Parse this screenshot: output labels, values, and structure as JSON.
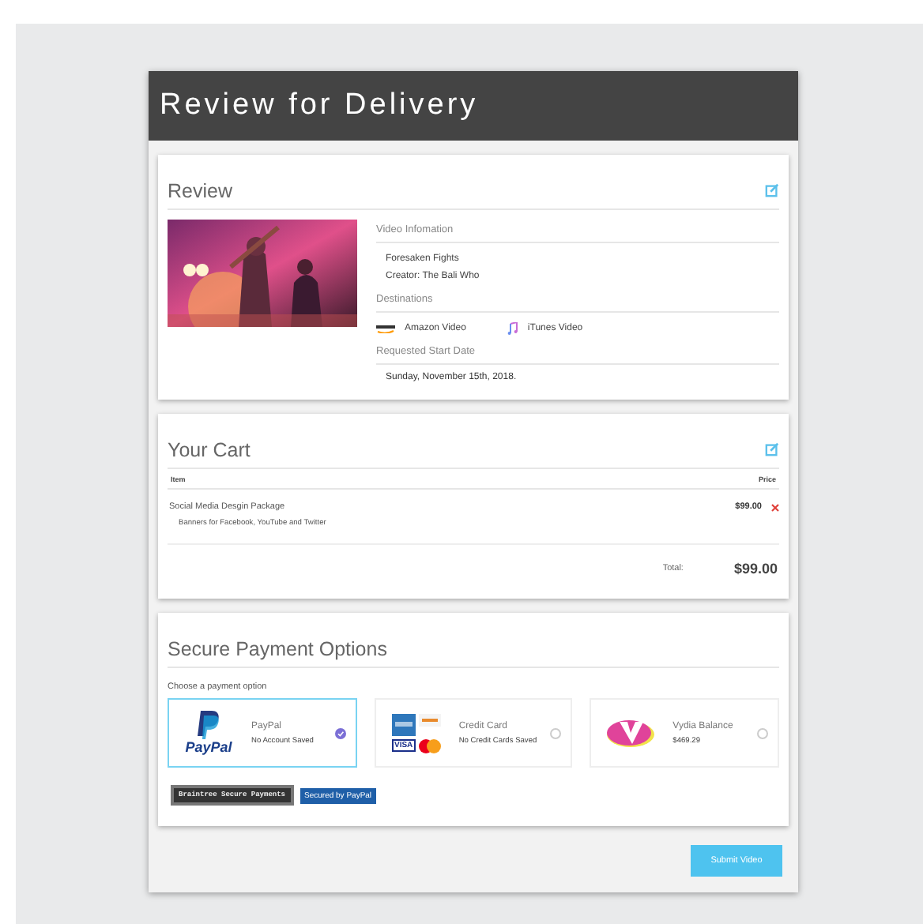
{
  "header": {
    "title": "Review for Delivery"
  },
  "review": {
    "title": "Review",
    "video_heading": "Video Infomation",
    "video_title": "Foresaken Fights",
    "creator": "Creator: The Bali Who",
    "destinations_heading": "Destinations",
    "destinations": [
      {
        "kind": "amazon",
        "label": "Amazon Video"
      },
      {
        "kind": "itunes",
        "label": "iTunes Video"
      }
    ],
    "date_heading": "Requested Start Date",
    "date": "Sunday, November 15th, 2018."
  },
  "cart": {
    "title": "Your Cart",
    "columns": [
      "Item",
      "Price"
    ],
    "items": [
      {
        "name": "Social Media Desgin Package",
        "description": "Banners for Facebook, YouTube and Twitter",
        "price": "$99.00"
      }
    ],
    "total_label": "Total:",
    "total": "$99.00"
  },
  "payment": {
    "title": "Secure Payment Options",
    "prompt": "Choose a payment option",
    "options": [
      {
        "kind": "paypal",
        "logo_text": "PayPal",
        "name": "PayPal",
        "detail": "No Account Saved",
        "selected": true
      },
      {
        "kind": "card",
        "logo_text": "VISA",
        "name": "Credit Card",
        "detail": "No Credit Cards Saved",
        "selected": false
      },
      {
        "kind": "vydia",
        "name": "Vydia Balance",
        "detail": "$469.29",
        "selected": false
      }
    ],
    "badges": [
      {
        "kind": "braintree",
        "text": "Braintree Secure Payments"
      },
      {
        "kind": "paypal",
        "text": "Secured by PayPal"
      }
    ]
  },
  "submit": "Submit Video"
}
